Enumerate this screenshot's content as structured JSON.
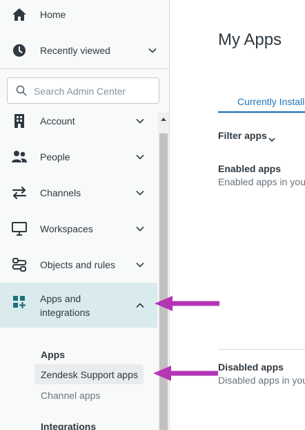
{
  "sidebar": {
    "top_items": [
      {
        "label": "Home",
        "icon": "home-icon"
      },
      {
        "label": "Recently viewed",
        "icon": "clock-icon"
      }
    ],
    "search": {
      "placeholder": "Search Admin Center"
    },
    "items": [
      {
        "label": "Account",
        "icon": "building-icon"
      },
      {
        "label": "People",
        "icon": "people-icon"
      },
      {
        "label": "Channels",
        "icon": "channels-icon"
      },
      {
        "label": "Workspaces",
        "icon": "monitor-icon"
      },
      {
        "label": "Objects and rules",
        "icon": "objects-icon"
      },
      {
        "label": "Apps and integrations",
        "label_line1": "Apps and",
        "label_line2": "integrations",
        "icon": "apps-grid-icon",
        "expanded": true
      }
    ],
    "submenu": {
      "apps_heading": "Apps",
      "apps_links": [
        {
          "label": "Zendesk Support apps",
          "selected": true
        },
        {
          "label": "Channel apps"
        }
      ],
      "integrations_heading": "Integrations"
    }
  },
  "main": {
    "title": "My Apps",
    "tabs": [
      {
        "label": "Currently Installed",
        "active": true
      }
    ],
    "filter_label": "Filter apps",
    "enabled": {
      "title": "Enabled apps",
      "subtitle": "Enabled apps in your Z"
    },
    "disabled": {
      "title": "Disabled apps",
      "subtitle": "Disabled apps in your"
    }
  },
  "colors": {
    "accent": "#1f73b7",
    "active_nav_bg": "#d9ebed",
    "annotation_arrow": "#b535b5",
    "sidebar_bg": "#f8f9f9"
  }
}
